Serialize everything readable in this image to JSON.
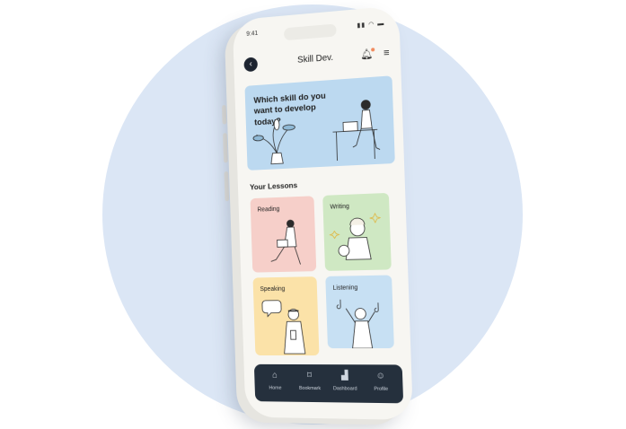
{
  "statusbar": {
    "time": "9:41",
    "icons": "▮▮ ◠ ▬"
  },
  "header": {
    "back_icon": "chevron-left-icon",
    "title": "Skill Dev.",
    "bell_icon": "bell-icon",
    "menu_icon": "menu-icon"
  },
  "hero": {
    "question": "Which skill do you want to develop today?"
  },
  "lessons": {
    "title": "Your Lessons",
    "items": [
      {
        "label": "Reading",
        "color": "#f6cfc9"
      },
      {
        "label": "Writing",
        "color": "#cfe8c3"
      },
      {
        "label": "Speaking",
        "color": "#fbe2a8"
      },
      {
        "label": "Listening",
        "color": "#c7e0f3"
      }
    ]
  },
  "tabbar": {
    "items": [
      {
        "label": "Home",
        "icon": "home-icon"
      },
      {
        "label": "Bookmark",
        "icon": "bookmark-icon"
      },
      {
        "label": "Dashboard",
        "icon": "chart-icon"
      },
      {
        "label": "Profile",
        "icon": "user-icon"
      }
    ]
  },
  "colors": {
    "background_circle": "#dbe6f5",
    "tabbar": "#25303d",
    "hero": "#bcd9f0"
  }
}
